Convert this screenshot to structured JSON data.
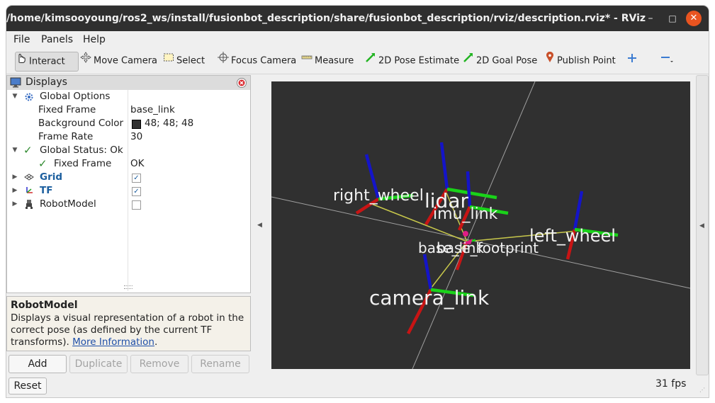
{
  "window": {
    "title": "/home/kimsooyoung/ros2_ws/install/fusionbot_description/share/fusionbot_description/rviz/description.rviz* - RViz",
    "minimize": "–",
    "maximize": "□",
    "close": "✕"
  },
  "menubar": {
    "file": "File",
    "panels": "Panels",
    "help": "Help"
  },
  "toolbar": {
    "interact": "Interact",
    "move_camera": "Move Camera",
    "select": "Select",
    "focus_camera": "Focus Camera",
    "measure": "Measure",
    "pose_estimate": "2D Pose Estimate",
    "goal_pose": "2D Goal Pose",
    "publish_point": "Publish Point"
  },
  "displays": {
    "title": "Displays",
    "global_options": "Global Options",
    "fixed_frame_label": "Fixed Frame",
    "fixed_frame_value": "base_link",
    "background_color_label": "Background Color",
    "background_color_value": "48; 48; 48",
    "background_color_swatch": "#303030",
    "frame_rate_label": "Frame Rate",
    "frame_rate_value": "30",
    "global_status": "Global Status: Ok",
    "status_fixed_frame_label": "Fixed Frame",
    "status_fixed_frame_value": "OK",
    "grid": "Grid",
    "tf": "TF",
    "robot_model": "RobotModel",
    "grid_checked": true,
    "tf_checked": true,
    "robot_model_checked": false
  },
  "help": {
    "title": "RobotModel",
    "text": "Displays a visual representation of a robot in the correct pose (as defined by the current TF transforms).",
    "link": "More Information",
    "suffix": "."
  },
  "buttons": {
    "add": "Add",
    "duplicate": "Duplicate",
    "remove": "Remove",
    "rename": "Rename",
    "reset": "Reset"
  },
  "viewport": {
    "labels": {
      "right_wheel": "right_wheel",
      "lidar": "lidar",
      "imu_link": "imu_link",
      "left_wheel": "left_wheel",
      "base_link": "base_link",
      "base_footprint": "base_footprint",
      "camera_link": "camera_link"
    },
    "colors": {
      "x_axis": "#c81414",
      "y_axis": "#19d219",
      "z_axis": "#1414c8",
      "link_line": "#c8c84b"
    }
  },
  "status": {
    "fps": "31 fps"
  }
}
